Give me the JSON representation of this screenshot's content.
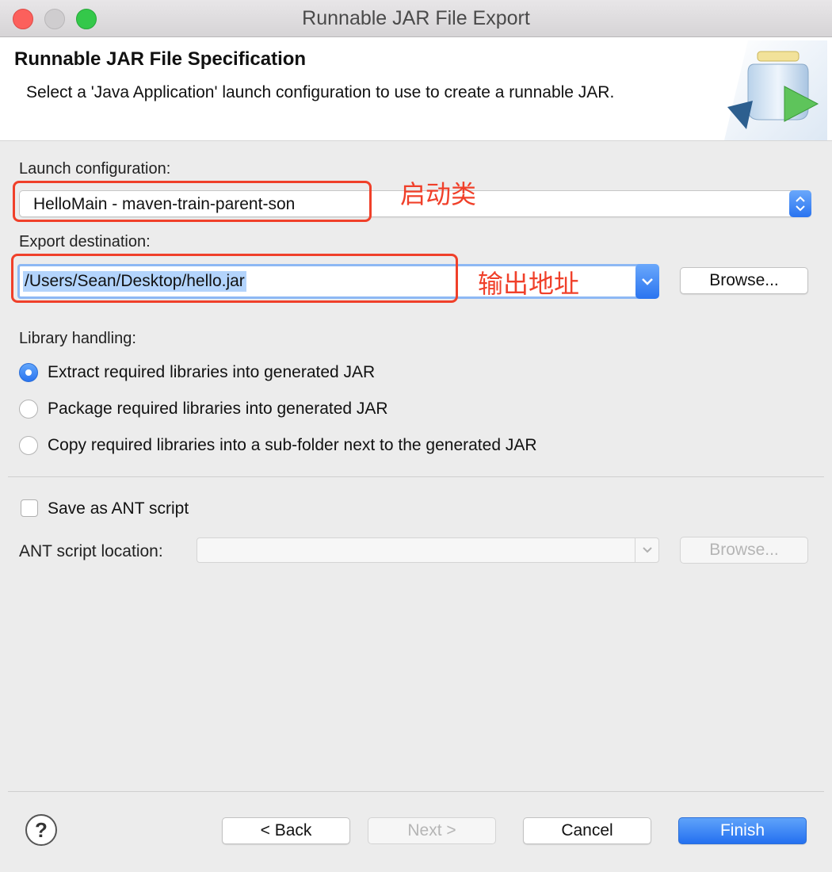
{
  "window": {
    "title": "Runnable JAR File Export"
  },
  "header": {
    "title": "Runnable JAR File Specification",
    "description": "Select a 'Java Application' launch configuration to use to create a runnable JAR."
  },
  "launch": {
    "label": "Launch configuration:",
    "value": "HelloMain - maven-train-parent-son",
    "annotation": "启动类"
  },
  "export": {
    "label": "Export destination:",
    "value": "/Users/Sean/Desktop/hello.jar",
    "browse": "Browse...",
    "annotation": "输出地址"
  },
  "library": {
    "label": "Library handling:",
    "options": [
      {
        "label": "Extract required libraries into generated JAR",
        "selected": true
      },
      {
        "label": "Package required libraries into generated JAR",
        "selected": false
      },
      {
        "label": "Copy required libraries into a sub-folder next to the generated JAR",
        "selected": false
      }
    ]
  },
  "ant": {
    "save_label": "Save as ANT script",
    "checked": false,
    "location_label": "ANT script location:",
    "browse": "Browse..."
  },
  "footer": {
    "help": "?",
    "back": "< Back",
    "next": "Next >",
    "cancel": "Cancel",
    "finish": "Finish"
  },
  "colors": {
    "accent": "#2a74f0",
    "annotation": "#f0402a",
    "selection": "#b3d4fc"
  }
}
